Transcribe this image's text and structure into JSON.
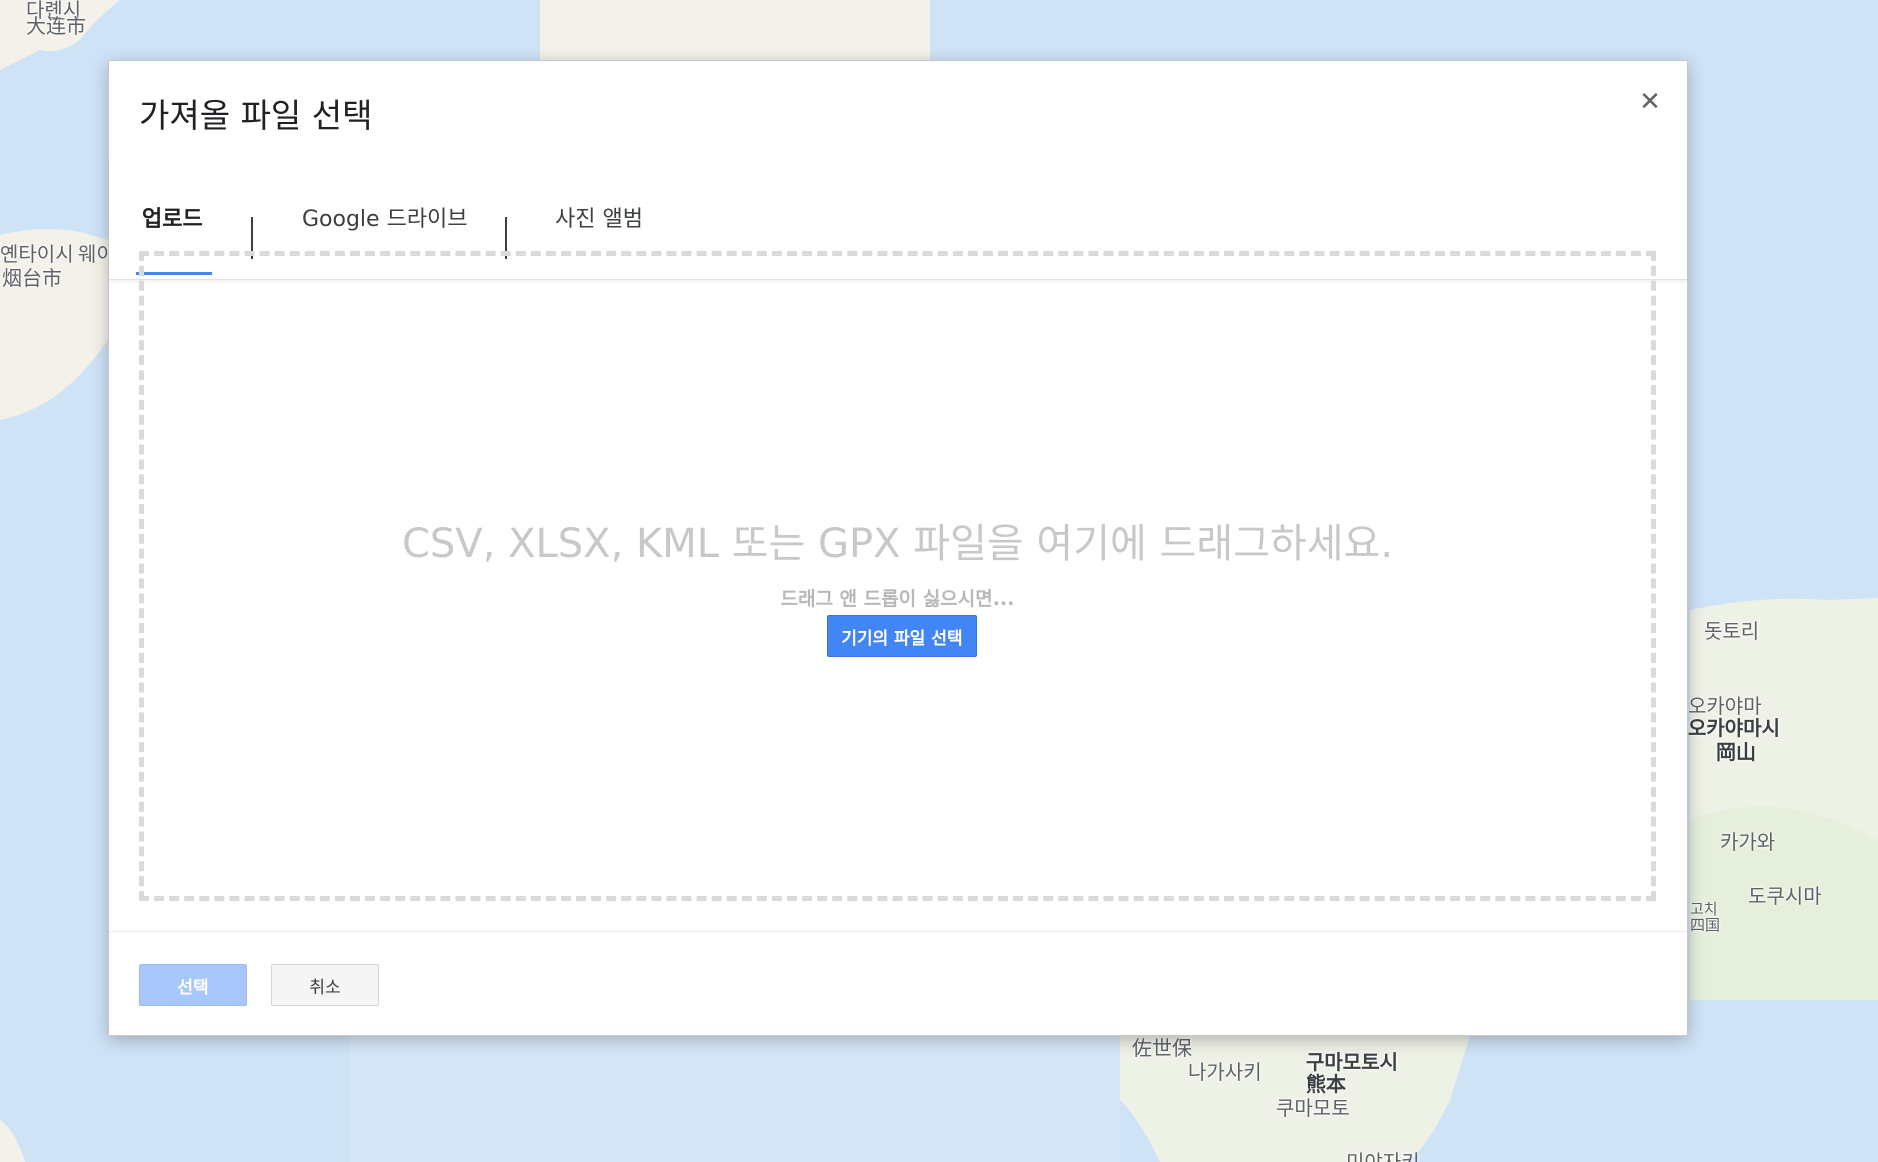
{
  "map": {
    "labels": [
      {
        "text": "다롄시"
      },
      {
        "text": "大连市"
      },
      {
        "text": "옌타이시"
      },
      {
        "text": "烟台市"
      },
      {
        "text": "웨이"
      },
      {
        "text": "돗토리"
      },
      {
        "text": "오카야마"
      },
      {
        "text": "오카야마시"
      },
      {
        "text": "岡山"
      },
      {
        "text": "카가와"
      },
      {
        "text": "도쿠시마"
      },
      {
        "text": "고치"
      },
      {
        "text": "四国"
      },
      {
        "text": "佐世保"
      },
      {
        "text": "나가사키"
      },
      {
        "text": "구마모토시"
      },
      {
        "text": "熊本"
      },
      {
        "text": "쿠마모토"
      },
      {
        "text": "미야자키"
      }
    ]
  },
  "dialog": {
    "title": "가져올 파일 선택",
    "close_icon": "close-icon",
    "tabs": [
      {
        "label": "업로드",
        "active": true
      },
      {
        "label": "Google 드라이브",
        "active": false
      },
      {
        "label": "사진 앨범",
        "active": false
      }
    ],
    "dropzone": {
      "main_text": "CSV, XLSX, KML 또는 GPX 파일을 여기에 드래그하세요.",
      "sub_text": "드래그 앤 드롭이 싫으시면...",
      "pick_button": "기기의 파일 선택"
    },
    "footer": {
      "select_button": "선택",
      "cancel_button": "취소"
    }
  },
  "colors": {
    "accent": "#4285f4",
    "select_disabled": "#a8c7fa",
    "water": "#cfe3f7",
    "land": "#f4f1ea"
  }
}
